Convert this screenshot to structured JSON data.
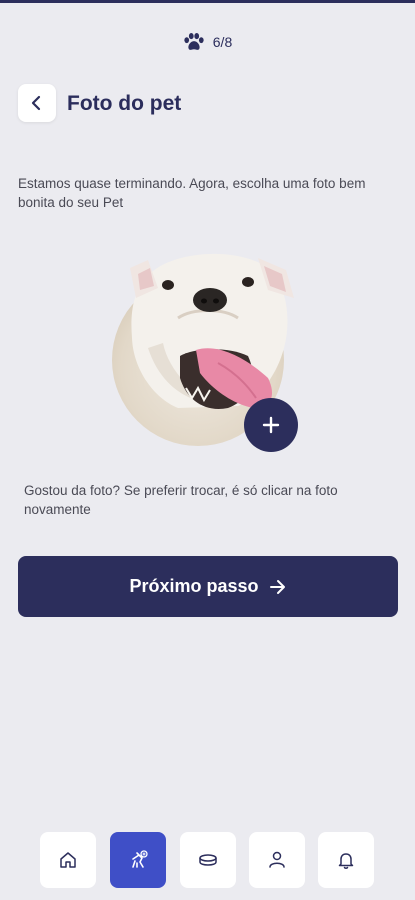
{
  "progress": {
    "label": "6/8",
    "icon": "paw-icon"
  },
  "header": {
    "title": "Foto do pet",
    "back_icon": "chevron-left-icon"
  },
  "intro_text": "Estamos quase terminando. Agora, escolha uma foto bem bonita do seu Pet",
  "photo": {
    "alt": "Foto do pet",
    "add_icon": "plus-icon"
  },
  "hint_text": "Gostou da foto? Se preferir trocar, é só clicar na foto novamente",
  "next_button": {
    "label": "Próximo passo",
    "icon": "arrow-right-icon"
  },
  "bottom_nav": {
    "items": [
      {
        "icon": "home-icon",
        "active": false
      },
      {
        "icon": "pet-icon",
        "active": true
      },
      {
        "icon": "bowl-icon",
        "active": false
      },
      {
        "icon": "user-icon",
        "active": false
      },
      {
        "icon": "bell-icon",
        "active": false
      }
    ]
  },
  "colors": {
    "primary": "#2c2e5c",
    "accent": "#3f4fc7",
    "background": "#ebebf0"
  }
}
